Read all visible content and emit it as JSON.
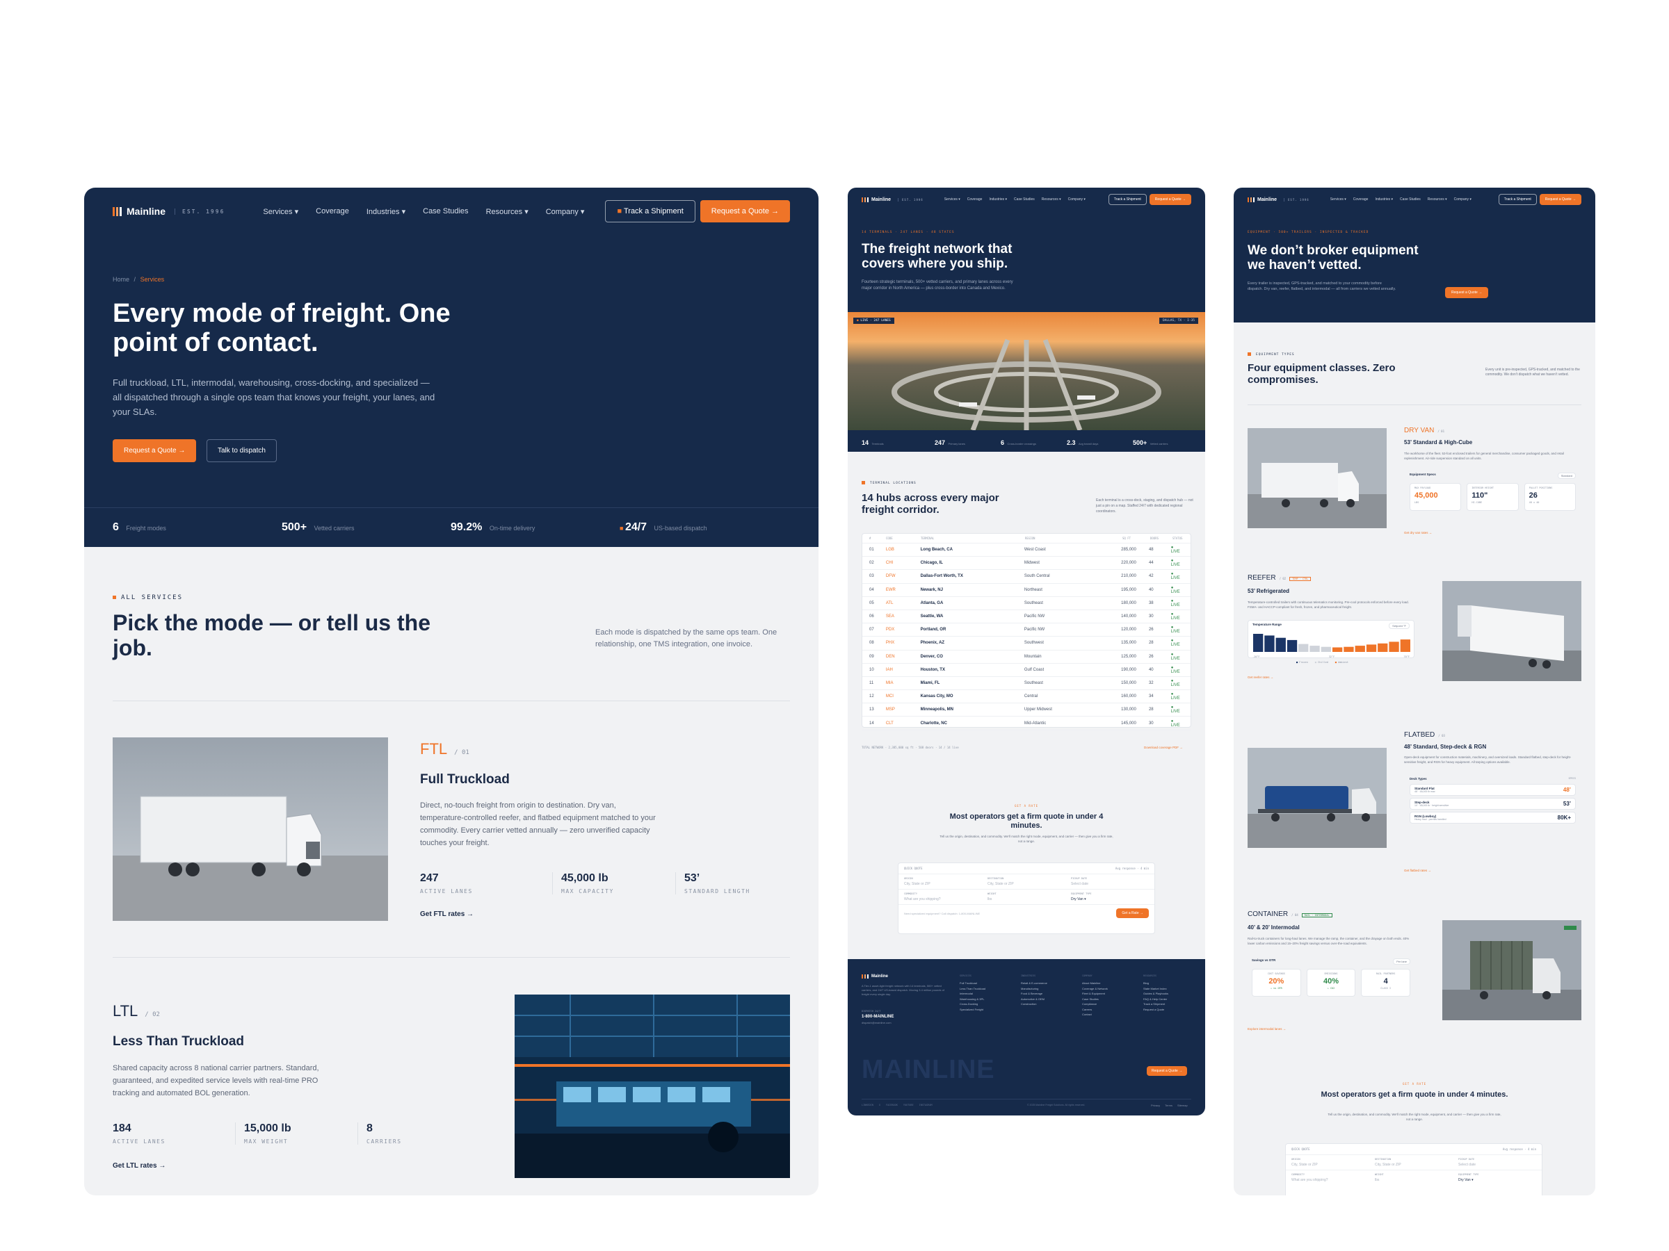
{
  "brand": {
    "name": "Mainline",
    "est": "EST. 1996"
  },
  "nav": [
    "Services ▾",
    "Coverage",
    "Industries ▾",
    "Case Studies",
    "Resources ▾",
    "Company ▾"
  ],
  "nav_small": [
    "Services ▾",
    "Coverage",
    "Industries ▾",
    "Case Studies",
    "Resources ▾",
    "Company ▾"
  ],
  "cta": {
    "track": "Track a Shipment",
    "quote": "Request a Quote →"
  },
  "p1": {
    "breadcrumb": {
      "home": "Home",
      "sep": "/",
      "current": "Services"
    },
    "hero_title": "Every mode of freight. One point of contact.",
    "hero_sub": "Full truckload, LTL, intermodal, warehousing, cross-docking, and specialized — all dispatched through a single ops team that knows your freight, your lanes, and your SLAs.",
    "btn_quote": "Request a Quote →",
    "btn_dispatch": "Talk to dispatch",
    "stats": [
      {
        "n": "6",
        "l": "Freight modes"
      },
      {
        "n": "500+",
        "l": "Vetted carriers"
      },
      {
        "n": "99.2%",
        "l": "On-time delivery"
      },
      {
        "n": "24/7",
        "l": "US-based dispatch"
      }
    ],
    "kicker": "ALL SERVICES",
    "section_title": "Pick the mode — or tell us the job.",
    "section_sub": "Each mode is dispatched by the same ops team. One relationship, one TMS integration, one invoice.",
    "ftl": {
      "code": "FTL",
      "num": "/ 01",
      "title": "Full Truckload",
      "desc": "Direct, no-touch freight from origin to destination. Dry van, temperature-controlled reefer, and flatbed equipment matched to your commodity. Every carrier vetted annually — zero unverified capacity touches your freight.",
      "stats": [
        {
          "n": "247",
          "l": "ACTIVE LANES"
        },
        {
          "n": "45,000 lb",
          "l": "MAX CAPACITY"
        },
        {
          "n": "53’",
          "l": "STANDARD LENGTH"
        }
      ],
      "link": "Get FTL rates →"
    },
    "ltl": {
      "code": "LTL",
      "num": "/ 02",
      "title": "Less Than Truckload",
      "desc": "Shared capacity across 8 national carrier partners. Standard, guaranteed, and expedited service levels with real-time PRO tracking and automated BOL generation.",
      "stats": [
        {
          "n": "184",
          "l": "ACTIVE LANES"
        },
        {
          "n": "15,000 lb",
          "l": "MAX WEIGHT"
        },
        {
          "n": "8",
          "l": "CARRIERS"
        }
      ],
      "link": "Get LTL rates →"
    }
  },
  "p2": {
    "kicker": "14 TERMINALS · 247 LANES · 48 STATES",
    "title": "The freight network that covers where you ship.",
    "sub": "Fourteen strategic terminals, 500+ vetted carriers, and primary lanes across every major corridor in North America — plus cross-border into Canada and Mexico.",
    "photo_tag": "LIVE · 247 LANES",
    "photo_tag2": "DALLAS, TX · I-35",
    "stats": [
      {
        "n": "14",
        "l": "Terminals"
      },
      {
        "n": "247",
        "l": "Primary lanes"
      },
      {
        "n": "6",
        "l": "Cross-border crossings"
      },
      {
        "n": "2.3",
        "l": "Avg transit days"
      },
      {
        "n": "500+",
        "l": "Vetted carriers"
      }
    ],
    "kicker2": "TERMINAL LOCATIONS",
    "title2": "14 hubs across every major freight corridor.",
    "sub2": "Each terminal is a cross-dock, staging, and dispatch hub — not just a pin on a map. Staffed 24/7 with dedicated regional coordinators.",
    "table_head": [
      "#",
      "CODE",
      "TERMINAL",
      "REGION",
      "SQ FT",
      "DOORS",
      "STATUS"
    ],
    "rows": [
      [
        "01",
        "LGB",
        "Long Beach, CA",
        "West Coast",
        "285,000",
        "48",
        "● LIVE"
      ],
      [
        "02",
        "CHI",
        "Chicago, IL",
        "Midwest",
        "220,000",
        "44",
        "● LIVE"
      ],
      [
        "03",
        "DFW",
        "Dallas-Fort Worth, TX",
        "South Central",
        "210,000",
        "42",
        "● LIVE"
      ],
      [
        "04",
        "EWR",
        "Newark, NJ",
        "Northeast",
        "195,000",
        "40",
        "● LIVE"
      ],
      [
        "05",
        "ATL",
        "Atlanta, GA",
        "Southeast",
        "180,000",
        "38",
        "● LIVE"
      ],
      [
        "06",
        "SEA",
        "Seattle, WA",
        "Pacific NW",
        "140,000",
        "30",
        "● LIVE"
      ],
      [
        "07",
        "PDX",
        "Portland, OR",
        "Pacific NW",
        "120,000",
        "26",
        "● LIVE"
      ],
      [
        "08",
        "PHX",
        "Phoenix, AZ",
        "Southwest",
        "135,000",
        "28",
        "● LIVE"
      ],
      [
        "09",
        "DEN",
        "Denver, CO",
        "Mountain",
        "125,000",
        "26",
        "● LIVE"
      ],
      [
        "10",
        "IAH",
        "Houston, TX",
        "Gulf Coast",
        "190,000",
        "40",
        "● LIVE"
      ],
      [
        "11",
        "MIA",
        "Miami, FL",
        "Southeast",
        "150,000",
        "32",
        "● LIVE"
      ],
      [
        "12",
        "MCI",
        "Kansas City, MO",
        "Central",
        "160,000",
        "34",
        "● LIVE"
      ],
      [
        "13",
        "MSP",
        "Minneapolis, MN",
        "Upper Midwest",
        "130,000",
        "28",
        "● LIVE"
      ],
      [
        "14",
        "CLT",
        "Charlotte, NC",
        "Mid-Atlantic",
        "145,000",
        "30",
        "● LIVE"
      ]
    ],
    "table_foot": "TOTAL NETWORK · 2,385,000 sq ft · 508 doors · 14 / 14 live",
    "table_link": "Download coverage PDF →",
    "quote_kicker": "GET A RATE",
    "quote_title": "Most operators get a firm quote in under 4 minutes.",
    "quote_sub": "Tell us the origin, destination, and commodity. We’ll match the right mode, equipment, and carrier — then give you a firm rate, not a range.",
    "form": {
      "head": "QUICK QUOTE",
      "head_r": "Avg response · 4 min",
      "origin": "ORIGIN",
      "origin_ph": "City, State or ZIP",
      "dest": "DESTINATION",
      "dest_ph": "City, State or ZIP",
      "date": "PICKUP DATE",
      "date_ph": "Select date",
      "commodity": "COMMODITY",
      "commodity_ph": "What are you shipping?",
      "weight": "WEIGHT",
      "weight_ph": "lbs",
      "equip": "EQUIPMENT TYPE",
      "equip_val": "Dry Van ▾",
      "note": "Need specialized equipment? Call dispatch: 1-800-MAINLINE",
      "btn": "Get a Rate →"
    },
    "footer": {
      "about": "A Tier-1 asset-light freight network with 14 terminals, 500+ vetted carriers, and 24/7 US-based dispatch. Moving 3.4 million pounds of freight every single day.",
      "phone_label": "DISPATCH 24/7",
      "phone": "1-800-MAINLINE",
      "email": "dispatch@mainline.com",
      "cols": [
        {
          "h": "SERVICES",
          "items": [
            "Full Truckload",
            "Less Than Truckload",
            "Intermodal",
            "Warehousing & 3PL",
            "Cross-Docking",
            "Specialized Freight"
          ]
        },
        {
          "h": "INDUSTRIES",
          "items": [
            "Retail & E-commerce",
            "Manufacturing",
            "Food & Beverage",
            "Automotive & OEM",
            "Construction"
          ]
        },
        {
          "h": "COMPANY",
          "items": [
            "About Mainline",
            "Coverage & Network",
            "Fleet & Equipment",
            "Case Studies",
            "Compliance",
            "Careers",
            "Contact"
          ]
        },
        {
          "h": "RESOURCES",
          "items": [
            "Blog",
            "State Market Index",
            "Guides & Playbooks",
            "FAQ & Help Center",
            "Track a Shipment",
            "Request a Quote"
          ]
        }
      ],
      "big": "MAINLINE",
      "btn": "Request a Quote →",
      "copy": "© 2025 Mainline Freight Solutions. All rights reserved.",
      "legal": [
        "Privacy",
        "Terms",
        "Sitemap"
      ],
      "social": [
        "LINKEDIN",
        "X",
        "FACEBOOK",
        "YOUTUBE",
        "INSTAGRAM"
      ]
    }
  },
  "p3": {
    "kicker": "EQUIPMENT · 500+ TRAILERS · INSPECTED & TRACKED",
    "title": "We don’t broker equipment we haven’t vetted.",
    "sub": "Every trailer is inspected, GPS-tracked, and matched to your commodity before dispatch. Dry van, reefer, flatbed, and intermodal — all from carriers we vetted annually.",
    "btn": "Request a Quote →",
    "kicker2": "EQUIPMENT TYPES",
    "title2": "Four equipment classes. Zero compromises.",
    "sub2": "Every unit is pre-inspected, GPS-tracked, and matched to the commodity. We don’t dispatch what we haven’t vetted.",
    "dryvan": {
      "code": "DRY VAN",
      "num": "/ 01",
      "title": "53’ Standard & High-Cube",
      "desc": "The workhorse of the fleet. 53-foot enclosed trailers for general merchandise, consumer packaged goods, and retail replenishment. Air-ride suspension standard on all units.",
      "spec_label": "Equipment Specs",
      "spec_btn": "Standard",
      "specs": [
        {
          "l": "MAX PAYLOAD",
          "n": "45,000",
          "u": "LBS"
        },
        {
          "l": "INTERIOR HEIGHT",
          "n": "110\"",
          "u": "HI-CUBE"
        },
        {
          "l": "PALLET POSITIONS",
          "n": "26",
          "u": "48 x 40"
        }
      ],
      "link": "Get dry van rates →"
    },
    "reefer": {
      "code": "REEFER",
      "num": "/ 02",
      "tag": "TEMP · CTRL",
      "title": "53’ Refrigerated",
      "desc": "Temperature-controlled trailers with continuous telematics monitoring. Pre-cool protocols enforced before every load. FSMA- and HACCP-compliant for fresh, frozen, and pharmaceutical freight.",
      "chart_label": "Temperature Range",
      "chart_btn": "Setpoint °F",
      "chart_axis": [
        "-20°F",
        "32°F",
        "70°F"
      ],
      "legend": [
        "Frozen",
        "Chilled",
        "Ambient"
      ],
      "link": "Get reefer rates →"
    },
    "flatbed": {
      "code": "FLATBED",
      "num": "/ 03",
      "title": "48’ Standard, Step-deck & RGN",
      "desc": "Open-deck equipment for construction materials, machinery, and oversized loads. Standard flatbed, step-deck for height-sensitive freight, and RGN for heavy equipment. All tarping options available.",
      "deck_label": "Deck Types",
      "deck_btn": "SPECS",
      "decks": [
        {
          "t": "Standard Flat",
          "s": "48’ · 48,000 lb max",
          "v": "48’"
        },
        {
          "t": "Step-deck",
          "s": "10’ · 48,000 lb · height sensitive",
          "v": "53’"
        },
        {
          "t": "RGN (Lowboy)",
          "s": "Heavy haul · permits handled",
          "v": "80K+"
        }
      ],
      "link": "Get flatbed rates →"
    },
    "container": {
      "code": "CONTAINER",
      "num": "/ 04",
      "tag": "RAIL · INTERMODAL",
      "title": "40’ & 20’ Intermodal",
      "desc": "Rail-to-truck containers for long-haul lanes. We manage the ramp, the container, and the drayage on both ends. 40% lower carbon emissions and 15–20% freight savings versus over-the-road equivalents.",
      "save_label": "Savings vs OTR",
      "save_btn": "Per lane",
      "saves": [
        {
          "l": "COST SAVINGS",
          "n": "20%",
          "u": "↓ vs OTR"
        },
        {
          "l": "EMISSIONS",
          "n": "40%",
          "u": "↓ CO2"
        },
        {
          "l": "RAIL PARTNERS",
          "n": "4",
          "u": "CLASS I"
        }
      ],
      "link": "Explore intermodal lanes →"
    },
    "quote_kicker": "GET A RATE",
    "quote_title": "Most operators get a firm quote in under 4 minutes.",
    "quote_sub": "Tell us the origin, destination, and commodity. We’ll match the right mode, equipment, and carrier — then give you a firm rate, not a range."
  },
  "chart_data": {
    "type": "bar",
    "values": [
      3.2,
      2.9,
      2.5,
      2.1,
      1.4,
      1.1,
      0.9,
      0.8,
      0.9,
      1.1,
      1.3,
      1.5,
      1.8,
      2.2
    ],
    "series_colors": [
      "#1b3566",
      "#1b3566",
      "#1b3566",
      "#1b3566",
      "#cfd3da",
      "#cfd3da",
      "#cfd3da",
      "#ef7428",
      "#ef7428",
      "#ef7428",
      "#ef7428",
      "#ef7428",
      "#ef7428",
      "#ef7428"
    ]
  },
  "colors": {
    "navy": "#162a4a",
    "orange": "#ef7428",
    "bg": "#f1f2f4"
  }
}
